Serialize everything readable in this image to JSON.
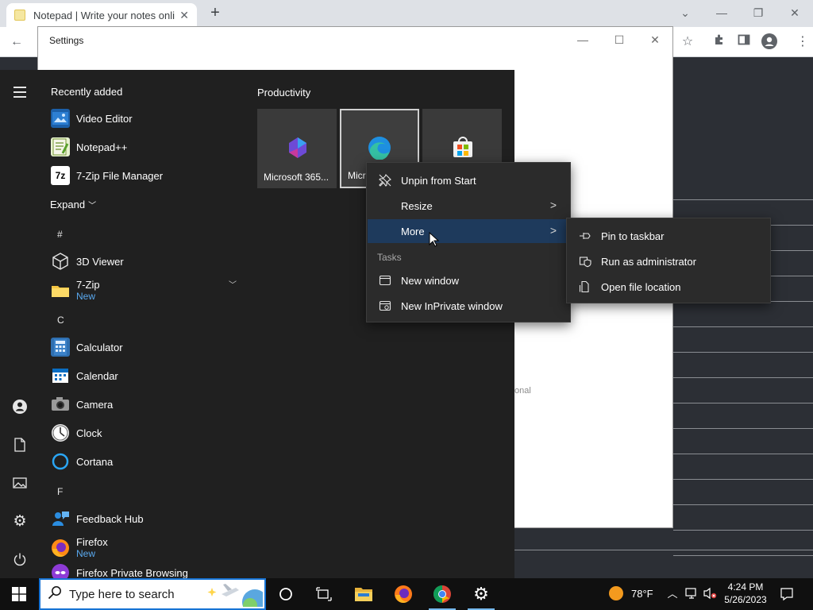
{
  "browser": {
    "tab_title": "Notepad | Write your notes online",
    "tab_close": "✕",
    "new_tab": "+"
  },
  "settings_window": {
    "title": "Settings",
    "background_fragment": "onal"
  },
  "start_menu": {
    "recently_added_title": "Recently added",
    "recent": [
      {
        "label": "Video Editor",
        "icon": "video-editor-icon"
      },
      {
        "label": "Notepad++",
        "icon": "notepadpp-icon"
      },
      {
        "label": "7-Zip File Manager",
        "icon": "7zip-icon"
      }
    ],
    "expand_label": "Expand",
    "letters": [
      "#",
      "C",
      "F"
    ],
    "apps": [
      {
        "label": "3D Viewer"
      },
      {
        "label": "7-Zip",
        "sub": "New"
      },
      {
        "label": "Calculator"
      },
      {
        "label": "Calendar"
      },
      {
        "label": "Camera"
      },
      {
        "label": "Clock"
      },
      {
        "label": "Cortana"
      },
      {
        "label": "Feedback Hub"
      },
      {
        "label": "Firefox",
        "sub": "New"
      },
      {
        "label": "Firefox Private Browsing"
      }
    ],
    "group_title": "Productivity",
    "tiles": [
      {
        "label": "Microsoft 365...",
        "icon": "microsoft-365-icon"
      },
      {
        "label": "Microsoft Edge",
        "icon": "edge-icon"
      },
      {
        "label": "",
        "icon": "microsoft-store-icon"
      }
    ]
  },
  "context_menu": {
    "items": [
      {
        "label": "Unpin from Start",
        "icon": "unpin-icon"
      },
      {
        "label": "Resize"
      },
      {
        "label": "More"
      }
    ],
    "tasks_header": "Tasks",
    "tasks": [
      {
        "label": "New window",
        "icon": "window-icon"
      },
      {
        "label": "New InPrivate window",
        "icon": "inprivate-icon"
      }
    ],
    "highlight_color": "#1e3a5c"
  },
  "submenu": {
    "items": [
      {
        "label": "Pin to taskbar",
        "icon": "pin-icon"
      },
      {
        "label": "Run as administrator",
        "icon": "shield-icon"
      },
      {
        "label": "Open file location",
        "icon": "folder-location-icon"
      }
    ]
  },
  "taskbar": {
    "search_placeholder": "Type here to search",
    "weather_temp": "78°F",
    "time": "4:24 PM",
    "date": "5/26/2023",
    "accent": "#1673d4"
  }
}
